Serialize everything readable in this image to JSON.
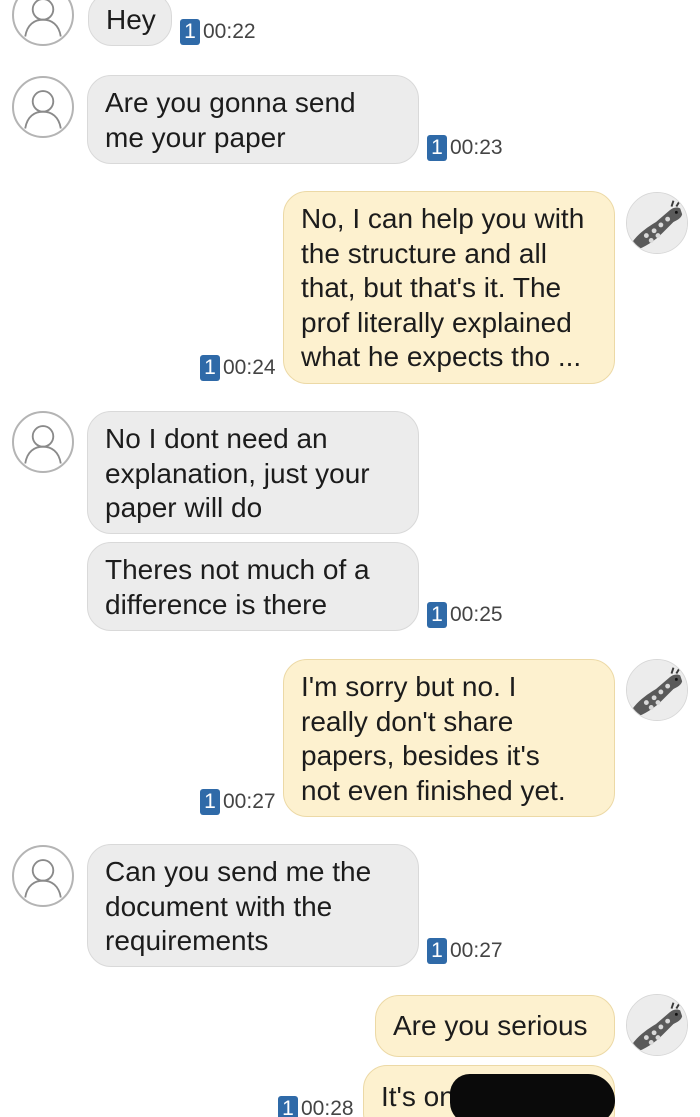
{
  "conversation": {
    "sim_badge": "1",
    "messages": [
      {
        "sender": "contact",
        "text": "Hey",
        "time": "00:22"
      },
      {
        "sender": "contact",
        "lines": [
          "Are you gonna send",
          "me your paper"
        ],
        "time": "00:23"
      },
      {
        "sender": "me",
        "lines": [
          "No, I can help you with",
          "the structure and all",
          "that, but that's it. The",
          "prof literally explained",
          "what he expects tho ..."
        ],
        "time": "00:24"
      },
      {
        "sender": "contact",
        "lines": [
          "No I dont need an",
          "explanation, just your",
          "paper will do"
        ]
      },
      {
        "sender": "contact",
        "lines": [
          "Theres not much of a",
          "difference is there"
        ],
        "time": "00:25"
      },
      {
        "sender": "me",
        "lines": [
          "I'm sorry but no. I",
          "really don't share",
          "papers, besides it's",
          "not even finished yet."
        ],
        "time": "00:27"
      },
      {
        "sender": "contact",
        "lines": [
          "Can you send me the",
          "document with the",
          "requirements"
        ],
        "time": "00:27"
      },
      {
        "sender": "me",
        "text": "Are you serious"
      },
      {
        "sender": "me",
        "text": "It's on",
        "time": "00:28",
        "redacted": true
      }
    ]
  },
  "colors": {
    "incoming_bubble": "#ececec",
    "outgoing_bubble": "#fdf1cf",
    "sim_badge": "#2f6aa8"
  },
  "icons": {
    "contact_avatar": "default-person-avatar-icon",
    "my_avatar": "giraffe-photo-avatar-icon"
  }
}
